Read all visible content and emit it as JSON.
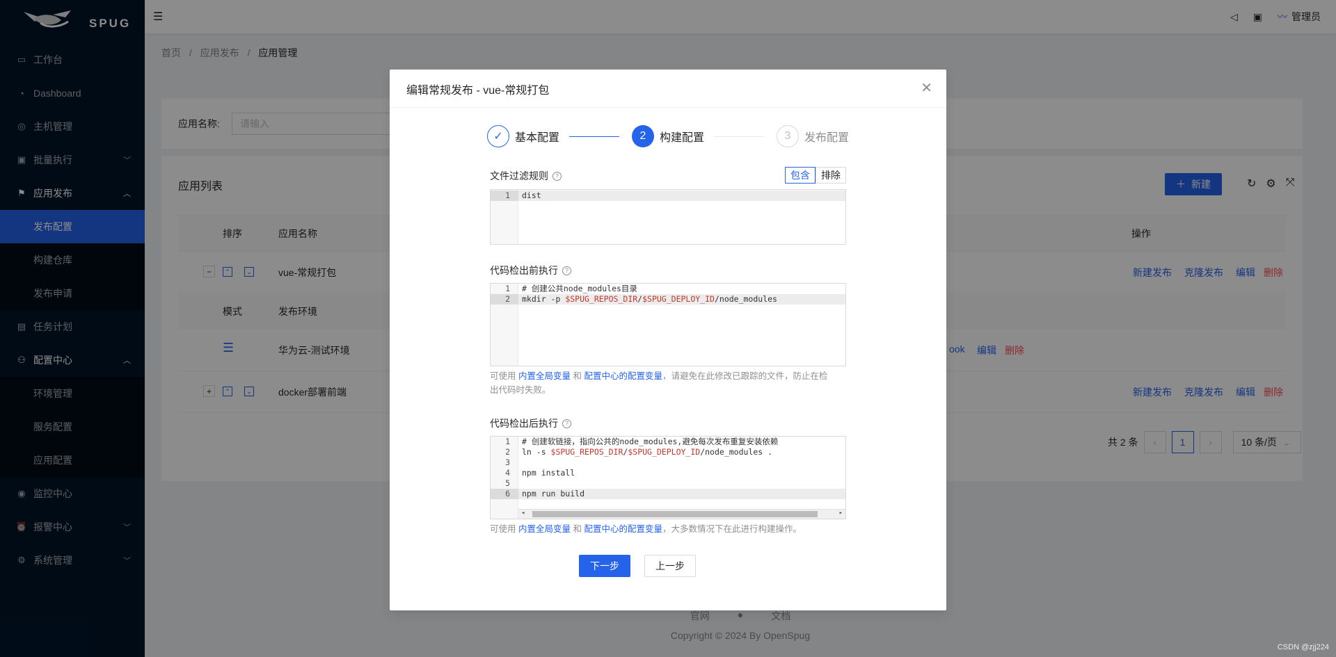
{
  "app": {
    "logo_text": "SPUG"
  },
  "sidebar": {
    "items": [
      {
        "label": "工作台",
        "icon": "desktop-icon"
      },
      {
        "label": "Dashboard",
        "icon": "dashboard-icon"
      },
      {
        "label": "主机管理",
        "icon": "cloud-server-icon"
      },
      {
        "label": "批量执行",
        "icon": "code-icon"
      },
      {
        "label": "应用发布",
        "icon": "flag-icon"
      },
      {
        "label": "发布配置"
      },
      {
        "label": "构建仓库"
      },
      {
        "label": "发布申请"
      },
      {
        "label": "任务计划",
        "icon": "schedule-icon"
      },
      {
        "label": "配置中心",
        "icon": "deployment-icon"
      },
      {
        "label": "环境管理"
      },
      {
        "label": "服务配置"
      },
      {
        "label": "应用配置"
      },
      {
        "label": "监控中心",
        "icon": "monitor-icon"
      },
      {
        "label": "报警中心",
        "icon": "alarm-icon"
      },
      {
        "label": "系统管理",
        "icon": "setting-icon"
      }
    ]
  },
  "header": {
    "user": "管理员"
  },
  "breadcrumb": [
    "首页",
    "/",
    "应用发布",
    "/",
    "应用管理"
  ],
  "search": {
    "label": "应用名称:",
    "placeholder": "请输入"
  },
  "list": {
    "title": "应用列表",
    "new_label": "新建",
    "columns": {
      "order": "排序",
      "name": "应用名称",
      "actions": "操作"
    },
    "rows": [
      {
        "expander": "−",
        "name": "vue-常规打包",
        "actions": [
          "新建发布",
          "克隆发布",
          "编辑",
          "删除"
        ]
      },
      {
        "expander": "+",
        "name": "docker部署前端",
        "actions": [
          "新建发布",
          "克隆发布",
          "编辑",
          "删除"
        ]
      }
    ],
    "sub_columns": {
      "mode": "模式",
      "env": "发布环境"
    },
    "sub_row": {
      "env": "华为云-测试环境",
      "link_partial": "ook",
      "edit": "编辑",
      "delete": "删除"
    },
    "pagination": {
      "total": "共 2 条",
      "page": "1",
      "size": "10 条/页"
    }
  },
  "footer": {
    "links": [
      "官网",
      "文档"
    ],
    "copyright": "Copyright © 2024 By OpenSpug"
  },
  "modal": {
    "title": "编辑常规发布 - vue-常规打包",
    "steps": [
      {
        "label": "基本配置",
        "state": "finish"
      },
      {
        "num": "2",
        "label": "构建配置",
        "state": "process"
      },
      {
        "num": "3",
        "label": "发布配置",
        "state": "wait"
      }
    ],
    "filter": {
      "label": "文件过滤规则",
      "include": "包含",
      "exclude": "排除",
      "lines": [
        "dist"
      ]
    },
    "pre": {
      "label": "代码检出前执行",
      "lines": [
        "# 创建公共node_modules目录",
        "mkdir -p $SPUG_REPOS_DIR/$SPUG_DEPLOY_ID/node_modules"
      ],
      "hint": {
        "prefix": "可使用 ",
        "link1": "内置全局变量",
        "mid": " 和 ",
        "link2": "配置中心的配置变量",
        "suffix": "，请避免在此修改已跟踪的文件，防止在检",
        "line2": "出代码时失败。"
      }
    },
    "post": {
      "label": "代码检出后执行",
      "lines": [
        "# 创建软链接，指向公共的node_modules,避免每次发布重复安装依赖",
        "ln -s $SPUG_REPOS_DIR/$SPUG_DEPLOY_ID/node_modules .",
        "",
        "npm install",
        "",
        "npm run build"
      ],
      "hint": {
        "prefix": "可使用 ",
        "link1": "内置全局变量",
        "mid": " 和 ",
        "link2": "配置中心的配置变量",
        "suffix": "，大多数情况下在此进行构建操作。"
      }
    },
    "next_label": "下一步",
    "prev_label": "上一步"
  },
  "watermark": "CSDN @zjj224",
  "colors": {
    "primary": "#2563eb",
    "sider": "#001529",
    "danger": "#ff4d4f"
  }
}
